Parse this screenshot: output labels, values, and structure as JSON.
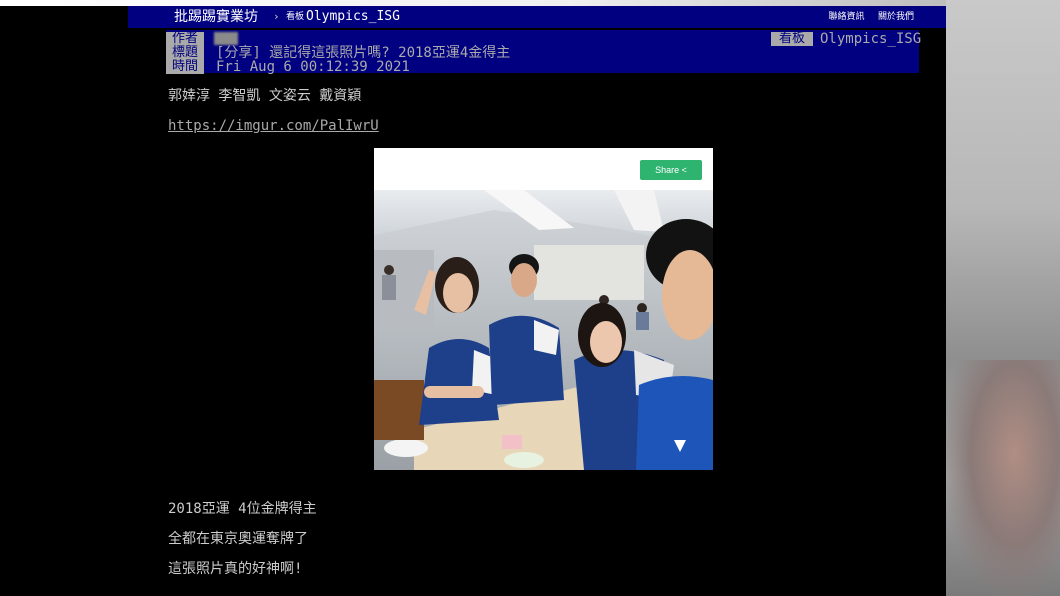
{
  "header": {
    "brand": "批踢踢實業坊",
    "separator": "›",
    "board_tag": "看板",
    "board_name": "Olympics_ISG",
    "links": [
      "聯絡資訊",
      "關於我們"
    ]
  },
  "meta": {
    "author_label": "作者",
    "title_label": "標題",
    "time_label": "時間",
    "board_label": "看板",
    "board_value": "Olympics_ISG",
    "title": "[分享] 還記得這張照片嗎? 2018亞運4金得主",
    "time": "Fri Aug  6 00:12:39 2021"
  },
  "content": {
    "names": "郭婞淳 李智凱 文姿云 戴資穎",
    "link": "https://imgur.com/PalIwrU",
    "line1": "2018亞運 4位金牌得主",
    "line2": "全都在東京奧運奪牌了",
    "line3": "這張照片真的好神啊!"
  },
  "photo": {
    "share_label": "Share"
  },
  "colors": {
    "header_bg": "#000080",
    "label_bg": "#aaaaaa",
    "share_green": "#2fb470"
  }
}
